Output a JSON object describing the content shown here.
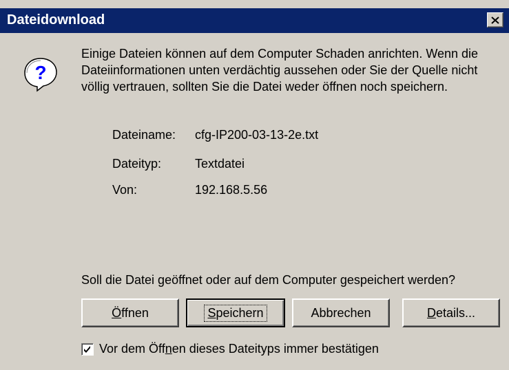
{
  "window": {
    "title": "Dateidownload"
  },
  "warning_text": "Einige Dateien können auf dem Computer Schaden anrichten. Wenn die Dateiinformationen unten verdächtig aussehen oder Sie der Quelle nicht völlig vertrauen, sollten Sie die Datei weder öffnen noch speichern.",
  "file_info": {
    "name_label": "Dateiname:",
    "name_value": "cfg-IP200-03-13-2e.txt",
    "type_label": "Dateityp:",
    "type_value": "Textdatei",
    "from_label": "Von:",
    "from_value": "192.168.5.56"
  },
  "question": "Soll die Datei geöffnet oder auf dem Computer gespeichert werden?",
  "buttons": {
    "open_u": "Ö",
    "open_rest": "ffnen",
    "save_u": "S",
    "save_rest": "peichern",
    "cancel": "Abbrechen",
    "details_u": "D",
    "details_rest": "etails..."
  },
  "checkbox": {
    "checked": true,
    "label_pre": "Vor dem Öff",
    "label_u": "n",
    "label_post": "en dieses Dateityps immer bestätigen"
  },
  "icons": {
    "question": "question-icon",
    "close": "close-icon",
    "check": "checkmark-icon"
  },
  "colors": {
    "titlebar": "#0a246a",
    "face": "#d4d0c8"
  }
}
